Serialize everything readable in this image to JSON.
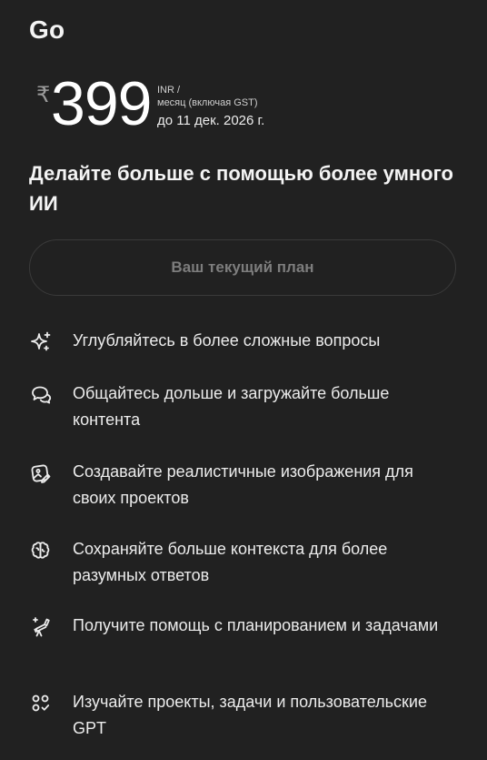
{
  "plan": {
    "name": "Go",
    "currency_symbol": "₹",
    "price": "399",
    "unit_line": "INR /",
    "period_line": "месяц (включая GST)",
    "valid_until": "до 11 дек. 2026 г.",
    "tagline": "Делайте больше с помощью более умного ИИ",
    "current_plan_label": "Ваш текущий план"
  },
  "features": [
    {
      "icon": "sparkle-icon",
      "text": "Углубляйтесь в более сложные вопросы"
    },
    {
      "icon": "chat-bubbles-icon",
      "text": "Общайтесь дольше и загружайте больше контента"
    },
    {
      "icon": "image-edit-icon",
      "text": "Создавайте реалистичные изображения для своих проектов"
    },
    {
      "icon": "brain-icon",
      "text": "Сохраняйте больше контекста для более разумных ответов"
    },
    {
      "icon": "telescope-icon",
      "text": "Получите помощь с планированием и задачами"
    },
    {
      "icon": "apps-check-icon",
      "text": "Изучайте проекты, задачи и пользовательские GPT"
    }
  ],
  "colors": {
    "background": "#212121",
    "text": "#ececec",
    "muted": "#7d7d7d",
    "border": "#3a3a3a"
  }
}
